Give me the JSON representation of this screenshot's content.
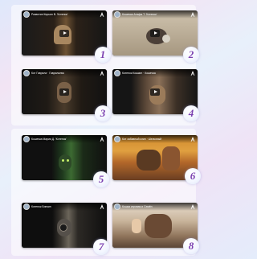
{
  "colors": {
    "number_color": "#7a3fb0",
    "panel": "#ffffff"
  },
  "videos": [
    {
      "title": "Развитие Кирьян В. 'Котенок'",
      "number": "1"
    },
    {
      "title": "Кошечка Альфа Т. 'Котенок'",
      "number": "2"
    },
    {
      "title": "Кот Гаврила · Гаврильева",
      "number": "3"
    },
    {
      "title": "Котенок Кошкин · Кошечка",
      "number": "4"
    },
    {
      "title": "Кошечка Мария Д. 'Котенок'",
      "number": "5"
    },
    {
      "title": "Кот забавный клип · Шелковый",
      "number": "6"
    },
    {
      "title": "Котенок Бинкин",
      "number": "7"
    },
    {
      "title": "Кошка игровая и Семён",
      "number": "8"
    }
  ]
}
